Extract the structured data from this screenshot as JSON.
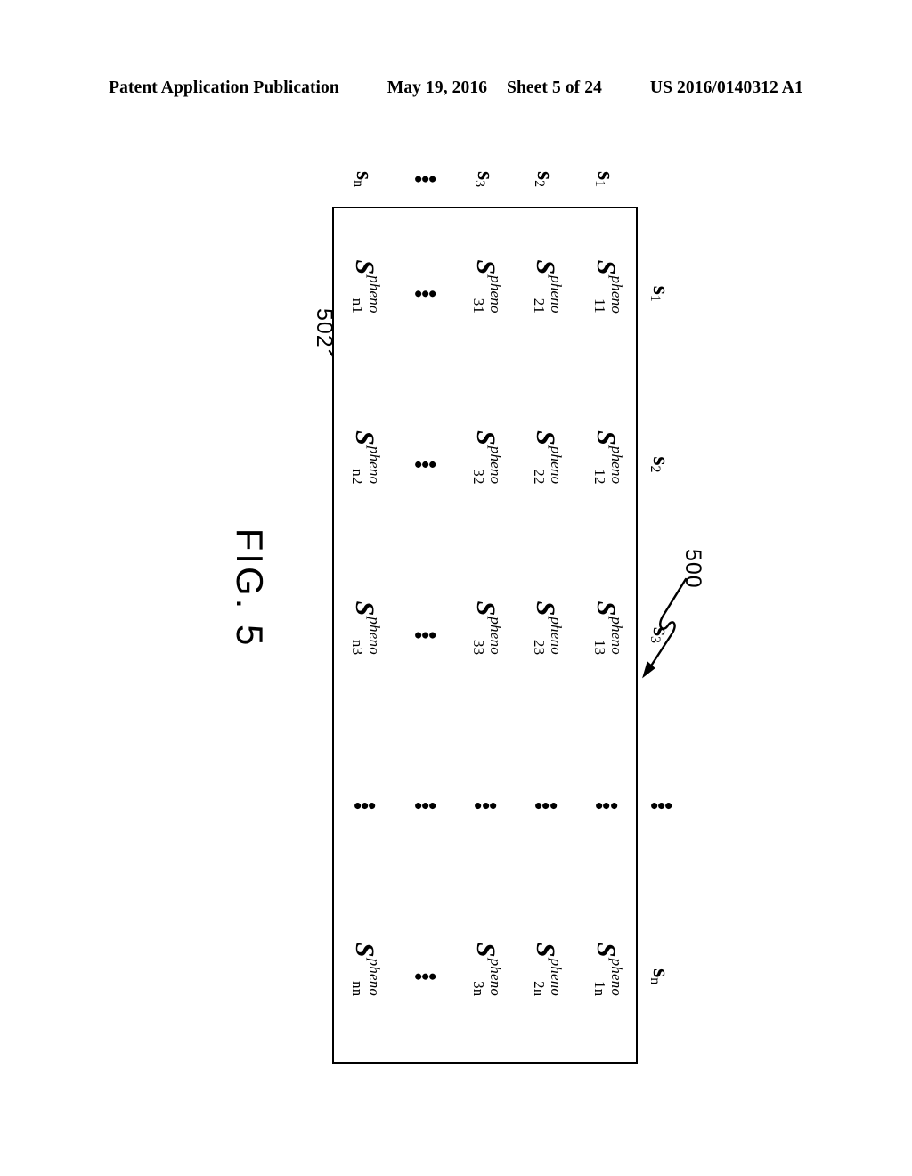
{
  "page_header": {
    "publication": "Patent Application Publication",
    "date": "May 19, 2016",
    "sheet": "Sheet 5 of 24",
    "document_number": "US 2016/0140312 A1"
  },
  "figure": {
    "caption": "FIG. 5",
    "reference_numerals": [
      {
        "id": "500",
        "label": "500",
        "points_to": "matrix-box"
      },
      {
        "id": "502",
        "label": "502",
        "points_to": "cell-1-2"
      }
    ],
    "matrix": {
      "symbol_base": "S",
      "superscript": "pheno",
      "ellipsis": "⋮",
      "column_headers": [
        {
          "base": "s",
          "sub": "1"
        },
        {
          "base": "s",
          "sub": "2"
        },
        {
          "base": "s",
          "sub": "3"
        },
        {
          "base": "⋮",
          "sub": ""
        },
        {
          "base": "s",
          "sub": "n"
        }
      ],
      "row_headers": [
        {
          "base": "s",
          "sub": "1"
        },
        {
          "base": "s",
          "sub": "2"
        },
        {
          "base": "s",
          "sub": "3"
        },
        {
          "base": "⋮",
          "sub": ""
        },
        {
          "base": "s",
          "sub": "n"
        }
      ],
      "cells": [
        [
          {
            "type": "sym",
            "base": "S",
            "sup": "pheno",
            "sub": "11"
          },
          {
            "type": "sym",
            "base": "S",
            "sup": "pheno",
            "sub": "12"
          },
          {
            "type": "sym",
            "base": "S",
            "sup": "pheno",
            "sub": "13"
          },
          {
            "type": "dots"
          },
          {
            "type": "sym",
            "base": "S",
            "sup": "pheno",
            "sub": "1n"
          }
        ],
        [
          {
            "type": "sym",
            "base": "S",
            "sup": "pheno",
            "sub": "21"
          },
          {
            "type": "sym",
            "base": "S",
            "sup": "pheno",
            "sub": "22"
          },
          {
            "type": "sym",
            "base": "S",
            "sup": "pheno",
            "sub": "23"
          },
          {
            "type": "dots"
          },
          {
            "type": "sym",
            "base": "S",
            "sup": "pheno",
            "sub": "2n"
          }
        ],
        [
          {
            "type": "sym",
            "base": "S",
            "sup": "pheno",
            "sub": "31"
          },
          {
            "type": "sym",
            "base": "S",
            "sup": "pheno",
            "sub": "32"
          },
          {
            "type": "sym",
            "base": "S",
            "sup": "pheno",
            "sub": "33"
          },
          {
            "type": "dots"
          },
          {
            "type": "sym",
            "base": "S",
            "sup": "pheno",
            "sub": "3n"
          }
        ],
        [
          {
            "type": "dots"
          },
          {
            "type": "dots"
          },
          {
            "type": "dots"
          },
          {
            "type": "dots"
          },
          {
            "type": "dots"
          }
        ],
        [
          {
            "type": "sym",
            "base": "S",
            "sup": "pheno",
            "sub": "n1"
          },
          {
            "type": "sym",
            "base": "S",
            "sup": "pheno",
            "sub": "n2"
          },
          {
            "type": "sym",
            "base": "S",
            "sup": "pheno",
            "sub": "n3"
          },
          {
            "type": "dots"
          },
          {
            "type": "sym",
            "base": "S",
            "sup": "pheno",
            "sub": "nn"
          }
        ]
      ]
    }
  },
  "colors": {
    "ink": "#000000",
    "paper": "#ffffff"
  }
}
